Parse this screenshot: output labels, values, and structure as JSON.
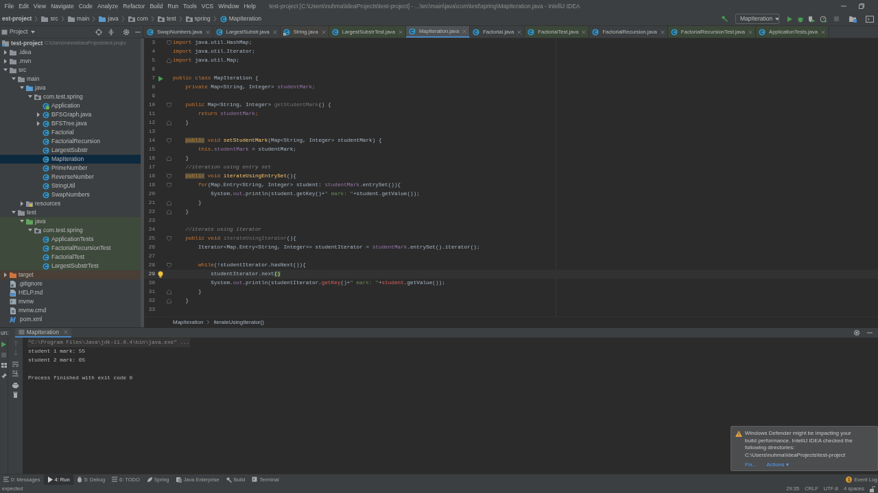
{
  "window": {
    "title": "test-project [C:\\Users\\nuhma\\IdeaProjects\\test-project] - ...\\src\\main\\java\\com\\test\\spring\\MapIteration.java - IntelliJ IDEA"
  },
  "menu": [
    "File",
    "Edit",
    "View",
    "Navigate",
    "Code",
    "Analyze",
    "Refactor",
    "Build",
    "Run",
    "Tools",
    "VCS",
    "Window",
    "Help"
  ],
  "breadcrumbs": [
    {
      "label": "est-project"
    },
    {
      "label": "src",
      "kind": "folder"
    },
    {
      "label": "main",
      "kind": "folder"
    },
    {
      "label": "java",
      "kind": "source-root"
    },
    {
      "label": "com",
      "kind": "package"
    },
    {
      "label": "test",
      "kind": "package"
    },
    {
      "label": "spring",
      "kind": "package"
    },
    {
      "label": "MapIteration",
      "kind": "class"
    }
  ],
  "run_configuration": "MapIteration",
  "project_panel": {
    "title": "Project"
  },
  "tabs": [
    {
      "label": "SwapNumbers.java",
      "kind": "class",
      "selected": false
    },
    {
      "label": "LargestSubstr.java",
      "kind": "class",
      "selected": false
    },
    {
      "label": "String.java",
      "kind": "library-class",
      "selected": false
    },
    {
      "label": "LargestSubstrTest.java",
      "kind": "test-class",
      "selected": false
    },
    {
      "label": "MapIteration.java",
      "kind": "class",
      "selected": true
    },
    {
      "label": "Factorial.java",
      "kind": "class",
      "selected": false
    },
    {
      "label": "FactorialTest.java",
      "kind": "test-class",
      "selected": false
    },
    {
      "label": "FactorialRecursion.java",
      "kind": "class",
      "selected": false
    },
    {
      "label": "FactorialRecursionTest.java",
      "kind": "test-class",
      "selected": false
    },
    {
      "label": "ApplicationTests.java",
      "kind": "test-class",
      "selected": false
    }
  ],
  "project_tree": [
    {
      "label": "test-project",
      "detail": "C:\\Users\\nuhma\\IdeaProjects\\test-projec",
      "kind": "module",
      "selected": false,
      "children": [
        {
          "label": ".idea",
          "kind": "folder",
          "expanded": false,
          "selected": false
        },
        {
          "label": ".mvn",
          "kind": "folder",
          "expanded": false,
          "selected": false
        },
        {
          "label": "src",
          "kind": "folder",
          "expanded": true,
          "selected": false,
          "children": [
            {
              "label": "main",
              "kind": "folder",
              "expanded": true,
              "selected": false,
              "children": [
                {
                  "label": "java",
                  "kind": "source-root",
                  "expanded": true,
                  "selected": false,
                  "children": [
                    {
                      "label": "com.test.spring",
                      "kind": "package",
                      "expanded": true,
                      "selected": false,
                      "children": [
                        {
                          "label": "Application",
                          "kind": "spring-class",
                          "selected": false
                        },
                        {
                          "label": "BFSGraph.java",
                          "kind": "class",
                          "expanded": false,
                          "selected": false
                        },
                        {
                          "label": "BFSTree.java",
                          "kind": "class",
                          "expanded": false,
                          "selected": false
                        },
                        {
                          "label": "Factorial",
                          "kind": "class",
                          "selected": false
                        },
                        {
                          "label": "FactorialRecursion",
                          "kind": "class",
                          "selected": false
                        },
                        {
                          "label": "LargestSubstr",
                          "kind": "class",
                          "selected": false
                        },
                        {
                          "label": "MapIteration",
                          "kind": "class",
                          "selected": true
                        },
                        {
                          "label": "PrimeNumber",
                          "kind": "class",
                          "selected": false
                        },
                        {
                          "label": "ReverseNumber",
                          "kind": "class",
                          "selected": false
                        },
                        {
                          "label": "StringUtil",
                          "kind": "class",
                          "selected": false
                        },
                        {
                          "label": "SwapNumbers",
                          "kind": "class",
                          "selected": false
                        }
                      ]
                    }
                  ]
                },
                {
                  "label": "resources",
                  "kind": "resources",
                  "expanded": false,
                  "selected": false
                }
              ]
            },
            {
              "label": "test",
              "kind": "folder",
              "expanded": true,
              "selected": false,
              "children": [
                {
                  "label": "java",
                  "kind": "test-root",
                  "expanded": true,
                  "selected": false,
                  "children": [
                    {
                      "label": "com.test.spring",
                      "kind": "test-package",
                      "expanded": true,
                      "selected": false,
                      "children": [
                        {
                          "label": "ApplicationTests",
                          "kind": "test-class",
                          "selected": false
                        },
                        {
                          "label": "FactorialRecursionTest",
                          "kind": "test-class",
                          "selected": false
                        },
                        {
                          "label": "FactorialTest",
                          "kind": "test-class",
                          "selected": false
                        },
                        {
                          "label": "LargestSubstrTest",
                          "kind": "test-class",
                          "selected": false
                        }
                      ]
                    }
                  ]
                }
              ]
            }
          ]
        },
        {
          "label": "target",
          "kind": "excluded",
          "expanded": false,
          "selected": false
        },
        {
          "label": ".gitignore",
          "kind": "gitignore",
          "selected": false
        },
        {
          "label": "HELP.md",
          "kind": "markdown",
          "selected": false
        },
        {
          "label": "mvnw",
          "kind": "script",
          "selected": false
        },
        {
          "label": "mvnw.cmd",
          "kind": "cmd",
          "selected": false
        },
        {
          "label": "pom.xml",
          "kind": "maven",
          "selected": false
        }
      ]
    }
  ],
  "code": {
    "lines": [
      {
        "number": "3",
        "kind": "fold-start",
        "selected": false,
        "tokens": [
          {
            "text": "import",
            "kind": "kw"
          },
          {
            "text": " java.util.HashMap;",
            "kind": "plain"
          }
        ]
      },
      {
        "number": "4",
        "selected": false,
        "tokens": [
          {
            "text": "import",
            "kind": "kw"
          },
          {
            "text": " java.util.Iterator;",
            "kind": "plain"
          }
        ]
      },
      {
        "number": "5",
        "kind": "fold-end",
        "selected": false,
        "tokens": [
          {
            "text": "import",
            "kind": "kw"
          },
          {
            "text": " java.util.Map;",
            "kind": "plain"
          }
        ]
      },
      {
        "number": "6",
        "selected": false
      },
      {
        "number": "7",
        "kind": "run",
        "selected": false,
        "tokens": [
          {
            "text": "public class",
            "kind": "kw"
          },
          {
            "text": " MapIteration {",
            "kind": "plain"
          }
        ]
      },
      {
        "number": "8",
        "selected": false,
        "tokens": [
          {
            "text": "    private",
            "kind": "kw"
          },
          {
            "text": " Map<String, Integer> ",
            "kind": "plain"
          },
          {
            "text": "studentMark",
            "kind": "field"
          },
          {
            "text": ";",
            "kind": "kw"
          }
        ]
      },
      {
        "number": "9",
        "selected": false
      },
      {
        "number": "10",
        "kind": "fold-start",
        "selected": false,
        "tokens": [
          {
            "text": "    public",
            "kind": "kw"
          },
          {
            "text": " Map<String, Integer> ",
            "kind": "plain"
          },
          {
            "text": "getStudentMark",
            "kind": "unused"
          },
          {
            "text": "() {",
            "kind": "plain"
          }
        ]
      },
      {
        "number": "11",
        "selected": false,
        "tokens": [
          {
            "text": "        return ",
            "kind": "kw"
          },
          {
            "text": "studentMark",
            "kind": "field"
          },
          {
            "text": ";",
            "kind": "kw"
          }
        ]
      },
      {
        "number": "12",
        "kind": "fold-end",
        "selected": false,
        "tokens": [
          {
            "text": "    }",
            "kind": "plain"
          }
        ]
      },
      {
        "number": "13",
        "selected": false
      },
      {
        "number": "14",
        "kind": "fold-start",
        "selected": false,
        "tokens": [
          {
            "text": "    public",
            "kind": "usage"
          },
          {
            "text": " void ",
            "kind": "kw"
          },
          {
            "text": "setStudentMark",
            "kind": "decl"
          },
          {
            "text": "(Map<String, Integer> studentMark) {",
            "kind": "plain"
          }
        ]
      },
      {
        "number": "15",
        "selected": false,
        "tokens": [
          {
            "text": "        this",
            "kind": "kw"
          },
          {
            "text": ".",
            "kind": "plain"
          },
          {
            "text": "studentMark",
            "kind": "field"
          },
          {
            "text": " = studentMark;",
            "kind": "plain"
          }
        ]
      },
      {
        "number": "16",
        "kind": "fold-end",
        "selected": false,
        "tokens": [
          {
            "text": "    }",
            "kind": "plain"
          }
        ]
      },
      {
        "number": "17",
        "selected": false,
        "tokens": [
          {
            "text": "    //iteration using entry set",
            "kind": "comment"
          }
        ]
      },
      {
        "number": "18",
        "kind": "fold-start",
        "selected": false,
        "tokens": [
          {
            "text": "    public",
            "kind": "usage"
          },
          {
            "text": " void ",
            "kind": "kw"
          },
          {
            "text": "iterateUsingEntrySet",
            "kind": "decl"
          },
          {
            "text": "(){",
            "kind": "plain"
          }
        ]
      },
      {
        "number": "19",
        "kind": "fold-start",
        "selected": false,
        "tokens": [
          {
            "text": "        for",
            "kind": "kw"
          },
          {
            "text": "(Map.Entry<String, Integer> student: ",
            "kind": "plain"
          },
          {
            "text": "studentMark",
            "kind": "field"
          },
          {
            "text": ".entrySet()){",
            "kind": "plain"
          }
        ]
      },
      {
        "number": "20",
        "selected": false,
        "tokens": [
          {
            "text": "            System.",
            "kind": "plain"
          },
          {
            "text": "out",
            "kind": "field"
          },
          {
            "text": ".println(student.getKey()+",
            "kind": "plain"
          },
          {
            "text": "\" mark: \"",
            "kind": "string"
          },
          {
            "text": "+student.getValue());",
            "kind": "plain"
          }
        ]
      },
      {
        "number": "21",
        "kind": "fold-end",
        "selected": false,
        "tokens": [
          {
            "text": "        }",
            "kind": "plain"
          }
        ]
      },
      {
        "number": "22",
        "kind": "fold-end",
        "selected": false,
        "tokens": [
          {
            "text": "    }",
            "kind": "plain"
          }
        ]
      },
      {
        "number": "23",
        "selected": false
      },
      {
        "number": "24",
        "selected": false,
        "tokens": [
          {
            "text": "    //iterate using iterator",
            "kind": "comment"
          }
        ]
      },
      {
        "number": "25",
        "kind": "fold-start",
        "selected": false,
        "tokens": [
          {
            "text": "    public void ",
            "kind": "kw"
          },
          {
            "text": "iterateUsingIterator",
            "kind": "unused"
          },
          {
            "text": "(){",
            "kind": "plain"
          }
        ]
      },
      {
        "number": "26",
        "selected": false,
        "tokens": [
          {
            "text": "        Iterator<Map.Entry<String, Integer>> studentIterator = ",
            "kind": "plain"
          },
          {
            "text": "studentMark",
            "kind": "field"
          },
          {
            "text": ".entrySet().iterator();",
            "kind": "plain"
          }
        ]
      },
      {
        "number": "27",
        "selected": false
      },
      {
        "number": "28",
        "kind": "fold-start",
        "selected": false,
        "tokens": [
          {
            "text": "        while",
            "kind": "kw"
          },
          {
            "text": "(!studentIterator.hasNext()){",
            "kind": "plain"
          }
        ]
      },
      {
        "number": "29",
        "kind": "bulb",
        "selected": true,
        "tokens": [
          {
            "text": "            studentIterator.next",
            "kind": "plain"
          },
          {
            "text": "()",
            "kind": "match"
          }
        ]
      },
      {
        "number": "30",
        "selected": false,
        "tokens": [
          {
            "text": "            System.",
            "kind": "plain"
          },
          {
            "text": "out",
            "kind": "field"
          },
          {
            "text": ".println(studentIterator.",
            "kind": "plain"
          },
          {
            "text": "getKey",
            "kind": "error"
          },
          {
            "text": "()+",
            "kind": "plain"
          },
          {
            "text": "\" mark: \"",
            "kind": "string"
          },
          {
            "text": "+",
            "kind": "plain"
          },
          {
            "text": "student",
            "kind": "error"
          },
          {
            "text": ".getValue());",
            "kind": "plain"
          }
        ]
      },
      {
        "number": "31",
        "kind": "fold-end",
        "selected": false,
        "tokens": [
          {
            "text": "        }",
            "kind": "plain"
          }
        ]
      },
      {
        "number": "32",
        "kind": "fold-end",
        "selected": false,
        "tokens": [
          {
            "text": "    }",
            "kind": "plain"
          }
        ]
      },
      {
        "number": "33",
        "selected": false
      }
    ],
    "breadcrumb": [
      "MapIteration",
      "iterateUsingIterator()"
    ]
  },
  "run_panel": {
    "label": "un:",
    "tab": "MapIteration",
    "console": [
      {
        "text": "\"C:\\Program Files\\Java\\jdk-11.0.4\\bin\\java.exe\" ...",
        "kind": "command"
      },
      {
        "text": "student 1 mark: 55",
        "kind": "output"
      },
      {
        "text": "student 2 mark: 65",
        "kind": "output"
      },
      {
        "text": "Process finished with exit code 0",
        "kind": "exit"
      }
    ]
  },
  "tool_windows": [
    {
      "label": "0: Messages",
      "kind": "messages",
      "selected": false
    },
    {
      "label": "4: Run",
      "kind": "run",
      "selected": true
    },
    {
      "label": "5: Debug",
      "kind": "debug",
      "selected": false
    },
    {
      "label": "6: TODO",
      "kind": "todo",
      "selected": false
    },
    {
      "label": "Spring",
      "kind": "spring",
      "selected": false
    },
    {
      "label": "Java Enterprise",
      "kind": "enterprise",
      "selected": false
    },
    {
      "label": "Build",
      "kind": "build",
      "selected": false
    },
    {
      "label": "Terminal",
      "kind": "terminal",
      "selected": false
    }
  ],
  "event_log": {
    "label": "Event Log",
    "count": "1"
  },
  "status_bar": {
    "message": "expected",
    "position": "29:35",
    "line_separator": "CRLF",
    "encoding": "UTF-8",
    "indent": "4 spaces"
  },
  "notification": {
    "message": "Windows Defender might be impacting your build performance. IntelliJ IDEA checked the following directories:",
    "path": "C:\\Users\\nuhma\\IdeaProjects\\test-project",
    "actions": [
      "Fix...",
      "Actions ▾"
    ]
  }
}
